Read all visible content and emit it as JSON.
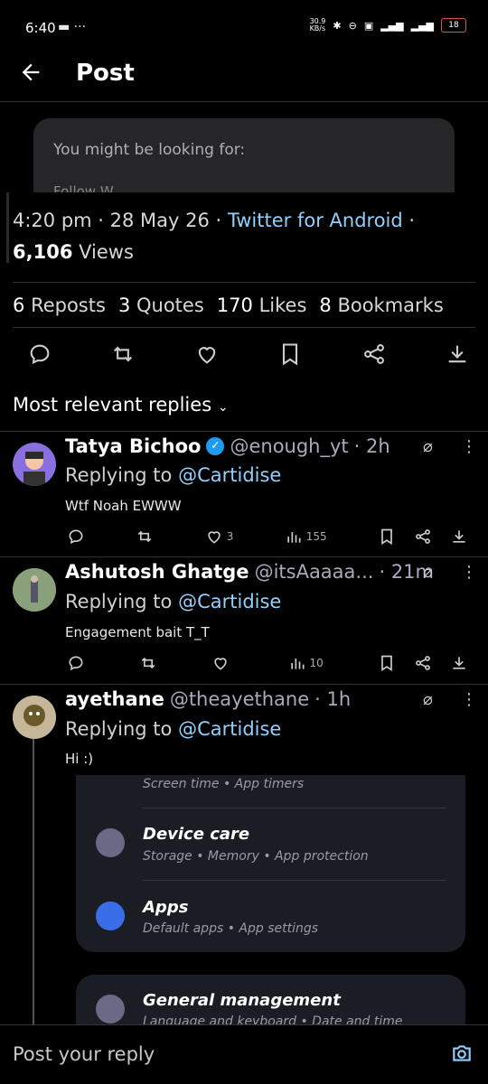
{
  "status": {
    "time": "6:40",
    "speed": "30.9\nKB/s",
    "battery": "18"
  },
  "header": {
    "title": "Post"
  },
  "suggest": {
    "text": "You might be looking for:",
    "more": "Follow W..."
  },
  "post": {
    "time": "4:20 pm",
    "date": "28 May 26",
    "source": "Twitter for Android",
    "views_count": "6,106",
    "views_label": "Views",
    "reposts": "6",
    "reposts_label": "Reposts",
    "quotes": "3",
    "quotes_label": "Quotes",
    "likes": "170",
    "likes_label": "Likes",
    "bookmarks": "8",
    "bookmarks_label": "Bookmarks"
  },
  "relevant_label": "Most relevant replies",
  "replies": [
    {
      "name": "Tatya Bichoo",
      "handle": "@enough_yt",
      "time": "2h",
      "replying": "Replying to",
      "to": "@Cartidise",
      "text": "Wtf Noah EWWW",
      "likes": "3",
      "views": "155"
    },
    {
      "name": "Ashutosh Ghatge",
      "handle": "@itsAaaaa...",
      "time": "21m",
      "replying": "Replying to",
      "to": "@Cartidise",
      "text": "Engagement bait T_T",
      "likes": "",
      "views": "10"
    },
    {
      "name": "ayethane",
      "handle": "@theayethane",
      "time": "1h",
      "replying": "Replying to",
      "to": "@Cartidise",
      "text": "Hi :)"
    }
  ],
  "overlay": {
    "top_sub": "Screen time  •  App timers",
    "item1_title": "Device care",
    "item1_sub": "Storage  •  Memory  •  App protection",
    "item2_title": "Apps",
    "item2_sub": "Default apps  •  App settings",
    "item3_title": "General management",
    "item3_sub": "Language and keyboard  •  Date and time"
  },
  "composer": {
    "placeholder": "Post your reply"
  }
}
